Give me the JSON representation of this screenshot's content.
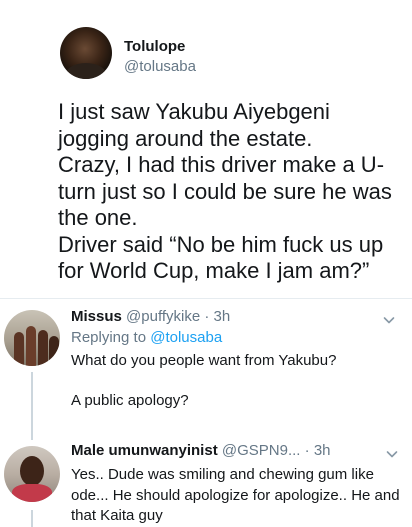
{
  "main_tweet": {
    "name": "Tolulope",
    "handle": "@tolusaba",
    "text": "I just saw Yakubu Aiyebgeni jogging around the estate.\nCrazy, I had this driver make a U-turn just so I could be sure he was the one.\nDriver said “No be him fuck us up for World Cup, make I jam am?”"
  },
  "replies": [
    {
      "name": "Missus",
      "handle": "@puffykike",
      "dot": "·",
      "time": "3h",
      "replying_prefix": "Replying to",
      "replying_to": "@tolusaba",
      "text": "What do you people want from Yakubu?\n\nA public apology?",
      "menu_icon": "chevron-down-icon"
    },
    {
      "name": "Male umunwanyinist",
      "handle": "@GSPN9...",
      "dot": "·",
      "time": "3h",
      "text": "Yes.. Dude was smiling and chewing gum like ode... He should apologize for apologize.. He and that Kaita guy",
      "menu_icon": "chevron-down-icon"
    }
  ],
  "colors": {
    "text": "#14171a",
    "secondary": "#657786",
    "link": "#1da1f2",
    "divider": "#e6ecf0"
  }
}
